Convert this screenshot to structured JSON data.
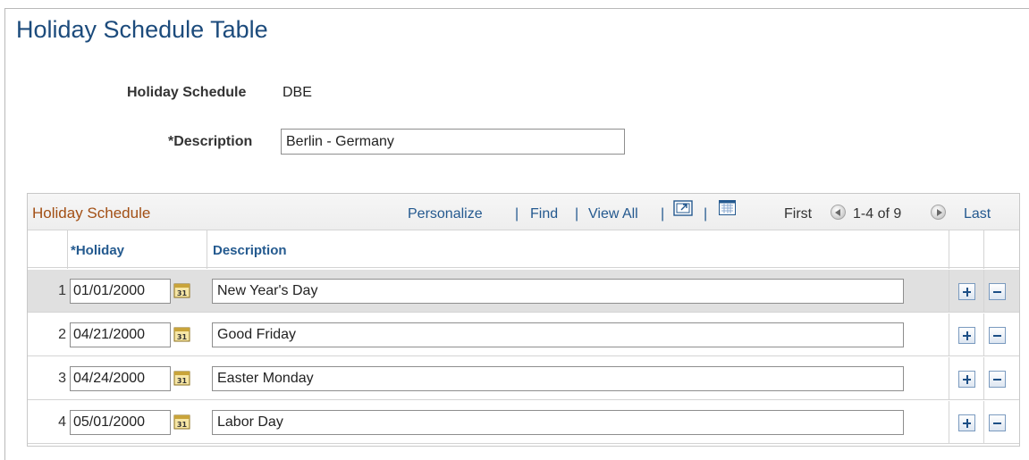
{
  "page": {
    "title": "Holiday Schedule Table"
  },
  "form": {
    "holiday_schedule_label": "Holiday Schedule",
    "holiday_schedule_value": "DBE",
    "description_label": "*Description",
    "description_value": "Berlin - Germany"
  },
  "grid": {
    "title": "Holiday Schedule",
    "personalize": "Personalize",
    "find": "Find",
    "view_all": "View All",
    "separator": "|",
    "first": "First",
    "range": "1-4 of 9",
    "last": "Last",
    "icons": [
      "zoom-icon",
      "download-grid-icon",
      "prev-circle-icon",
      "next-circle-icon",
      "calendar-icon",
      "add-row-icon",
      "delete-row-icon"
    ],
    "columns": {
      "holiday": "*Holiday",
      "description": "Description"
    },
    "rows": [
      {
        "num": "1",
        "date": "01/01/2000",
        "description": "New Year's Day"
      },
      {
        "num": "2",
        "date": "04/21/2000",
        "description": "Good Friday"
      },
      {
        "num": "3",
        "date": "04/24/2000",
        "description": "Easter Monday"
      },
      {
        "num": "4",
        "date": "05/01/2000",
        "description": "Labor Day"
      }
    ]
  },
  "colors": {
    "title": "#1c4b7c",
    "grid_title": "#a24f14",
    "link": "#24598f",
    "selected_row": "#e0e0e0"
  }
}
